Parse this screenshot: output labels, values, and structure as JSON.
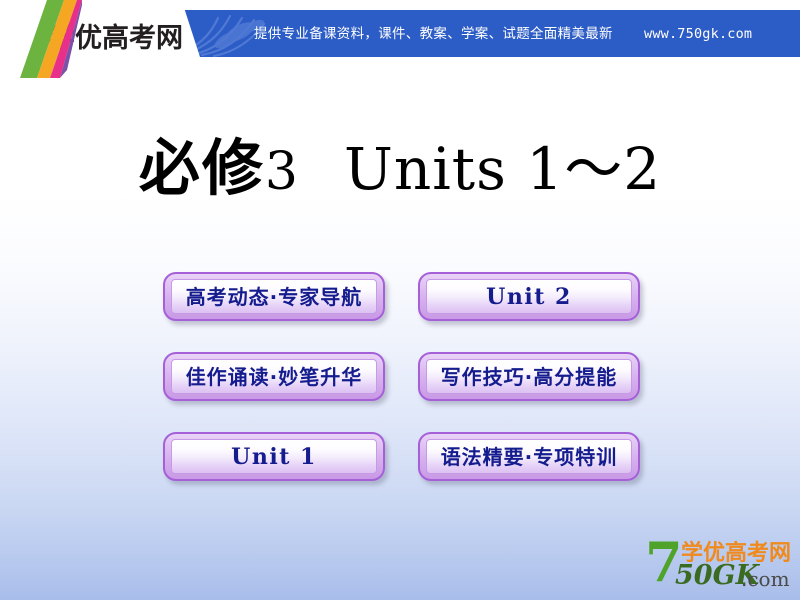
{
  "banner": {
    "logo_text": "学优高考网",
    "tagline": "提供专业备课资料，课件、教案、学案、试题全面精美最新",
    "url": "www.750gk.com",
    "bar_color": "#2c5cc5",
    "stripe_colors": [
      "#6cb33f",
      "#f5a623",
      "#e8308a",
      "#7b52a8"
    ]
  },
  "title": {
    "chinese": "必修",
    "number": "3",
    "english": "Units 1～2",
    "color": "#000000"
  },
  "buttons": [
    {
      "id": "gaokao-dongtai",
      "label": "高考动态·专家导航",
      "lang": "cn",
      "row": 1,
      "col": "l"
    },
    {
      "id": "unit-2",
      "label": "Unit  2",
      "lang": "en",
      "row": 1,
      "col": "r"
    },
    {
      "id": "jiazuo-songdu",
      "label": "佳作诵读·妙笔升华",
      "lang": "cn",
      "row": 2,
      "col": "l"
    },
    {
      "id": "xiezuo-jiqiao",
      "label": "写作技巧·高分提能",
      "lang": "cn",
      "row": 2,
      "col": "r"
    },
    {
      "id": "unit-1",
      "label": "Unit  1",
      "lang": "en",
      "row": 3,
      "col": "l"
    },
    {
      "id": "yufa-jingyao",
      "label": "语法精要·专项特训",
      "lang": "cn",
      "row": 3,
      "col": "r"
    }
  ],
  "button_style": {
    "border_color": "#a560d8",
    "fill_top": "#ffffff",
    "fill_bottom": "#dcc0f2",
    "text_color": "#151c8e"
  },
  "watermark": {
    "seven": "7",
    "cn": "学优高考网",
    "code": "50GK",
    "domain": ".com",
    "green": "#4fa32b",
    "orange": "#f08a1e",
    "dark": "#3a6b20"
  },
  "background": {
    "top_color": "#ffffff",
    "bottom_color": "#a8bdea"
  }
}
